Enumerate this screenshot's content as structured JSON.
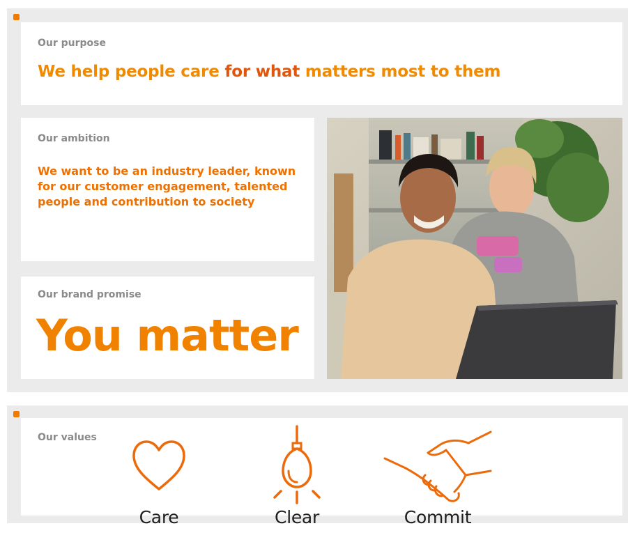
{
  "purpose": {
    "label": "Our purpose",
    "text_part1": "We help people care ",
    "text_accent": "for what",
    "text_part2": " matters most to them"
  },
  "ambition": {
    "label": "Our ambition",
    "text": "We want to be an industry leader, known for our customer engagement, talented people and contribution to society"
  },
  "promise": {
    "label": "Our brand promise",
    "text": "You matter"
  },
  "photo": {
    "icon": "people-at-laptop-photo"
  },
  "values": {
    "label": "Our values",
    "items": [
      {
        "label": "Care",
        "icon": "heart-icon"
      },
      {
        "label": "Clear",
        "icon": "lightbulb-icon"
      },
      {
        "label": "Commit",
        "icon": "handshake-icon"
      }
    ]
  },
  "colors": {
    "brand_orange": "#f08200",
    "accent_orange": "#e0560c",
    "panel_grey": "#ebebeb",
    "label_grey": "#8a8a8a"
  }
}
